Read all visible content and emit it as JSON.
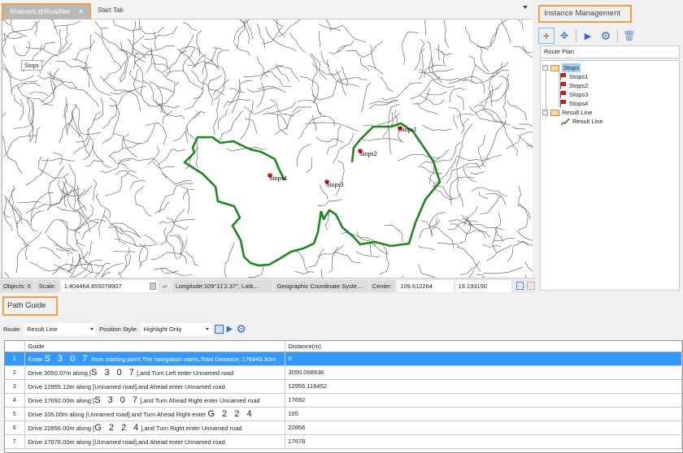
{
  "document_tabs": {
    "active": "RhainanL@RoadNet",
    "close_glyph": "×",
    "start": "Start Tab"
  },
  "map": {
    "layer_tooltip": "Stops",
    "stops": [
      {
        "label": "Stops1"
      },
      {
        "label": "Stops2"
      },
      {
        "label": "Stops3"
      },
      {
        "label": "Stops4"
      }
    ],
    "route_color": "#1a8a1a",
    "stop_color": "#e41010"
  },
  "statusbar": {
    "objects": "Objects: 0",
    "scale_label": "Scale:",
    "scale_value": "1:404464.855078907",
    "swap_icon": "⇌",
    "coords": "Longitude:109°11'2.37\", Latit...",
    "crs": "Geographic Coordinate Syste...",
    "center_label": "Center:",
    "center_x": "109.612264",
    "center_y": "19.193150"
  },
  "instance_management": {
    "title": "Instance Management",
    "route_plan": "Route Plan",
    "tree": {
      "stops_group": "Stops",
      "stops": [
        "Stops1",
        "Stops2",
        "Stops3",
        "Stops4"
      ],
      "result_group": "Result Line",
      "result_item": "Result Line"
    }
  },
  "path_guide": {
    "title": "Path Guide",
    "route_label": "Route:",
    "route_value": "Result Line",
    "position_label": "Position Style:",
    "position_value": "Highlight Only",
    "columns": [
      "Guide",
      "Distance(m)"
    ],
    "rows": [
      {
        "n": "1",
        "pre": "Enter ",
        "big": "S 3 0 7",
        "post": " from starting point,The navigation starts,Total Distance: 176943.30m",
        "dist": "0"
      },
      {
        "n": "2",
        "pre": "Drive 3050.07m along [",
        "big": "S 3 0 7",
        "post": "],and Turn Left enter Unnamed road",
        "dist": "3050.068936"
      },
      {
        "n": "3",
        "pre": "Drive 12955.12m along [Unnamed road],and Ahead enter Unnamed road",
        "big": "",
        "post": "",
        "dist": "12955.116452"
      },
      {
        "n": "4",
        "pre": "Drive 17692.00m along [",
        "big": "S 3 0 7",
        "post": "],and Turn Ahead Right enter Unnamed road",
        "dist": "17692"
      },
      {
        "n": "5",
        "pre": "Drive 105.00m along [Unnamed road],and Turn Ahead Right enter ",
        "big": "G 2 2 4",
        "post": "",
        "dist": "105"
      },
      {
        "n": "6",
        "pre": "Drive 22856.00m along [",
        "big": "G 2 2 4",
        "post": "],and Turn Right enter Unnamed road",
        "dist": "22856"
      },
      {
        "n": "7",
        "pre": "Drive 17678.00m along [Unnamed road],and Ahead enter Unnamed road",
        "big": "",
        "post": "",
        "dist": "17678"
      }
    ]
  }
}
